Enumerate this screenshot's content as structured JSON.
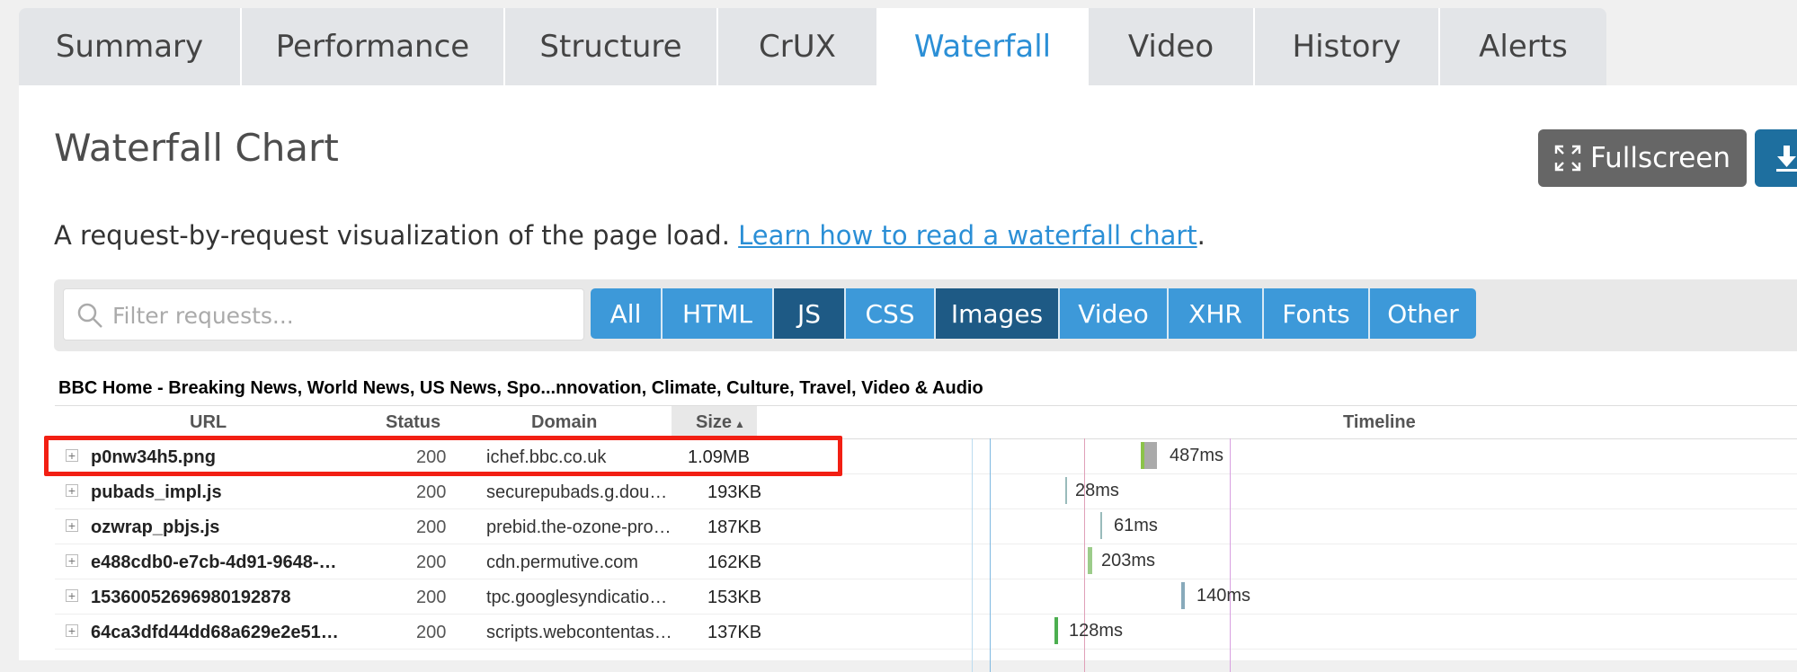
{
  "tabs": [
    {
      "label": "Summary",
      "active": false
    },
    {
      "label": "Performance",
      "active": false
    },
    {
      "label": "Structure",
      "active": false
    },
    {
      "label": "CrUX",
      "active": false
    },
    {
      "label": "Waterfall",
      "active": true
    },
    {
      "label": "Video",
      "active": false
    },
    {
      "label": "History",
      "active": false
    },
    {
      "label": "Alerts",
      "active": false
    }
  ],
  "header": {
    "title": "Waterfall Chart",
    "fullscreen_label": "Fullscreen"
  },
  "description": {
    "text": "A request-by-request visualization of the page load. ",
    "link": "Learn how to read a waterfall chart",
    "suffix": "."
  },
  "filter": {
    "placeholder": "Filter requests...",
    "buttons": [
      {
        "label": "All",
        "active": false
      },
      {
        "label": "HTML",
        "active": false
      },
      {
        "label": "JS",
        "active": true
      },
      {
        "label": "CSS",
        "active": false
      },
      {
        "label": "Images",
        "active": true
      },
      {
        "label": "Video",
        "active": false
      },
      {
        "label": "XHR",
        "active": false
      },
      {
        "label": "Fonts",
        "active": false
      },
      {
        "label": "Other",
        "active": false
      }
    ]
  },
  "page_name": "BBC Home - Breaking News, World News, US News, Spo...nnovation, Climate, Culture, Travel, Video & Audio",
  "table": {
    "headers": {
      "url": "URL",
      "status": "Status",
      "domain": "Domain",
      "size": "Size",
      "timeline": "Timeline"
    },
    "sort_indicator": "▲",
    "rows": [
      {
        "url": "p0nw34h5.png",
        "status": "200",
        "domain": "ichef.bbc.co.uk",
        "size": "1.09MB",
        "duration": "487ms"
      },
      {
        "url": "pubads_impl.js",
        "status": "200",
        "domain": "securepubads.g.dou…",
        "size": "193KB",
        "duration": "28ms"
      },
      {
        "url": "ozwrap_pbjs.js",
        "status": "200",
        "domain": "prebid.the-ozone-pro…",
        "size": "187KB",
        "duration": "61ms"
      },
      {
        "url": "e488cdb0-e7cb-4d91-9648-…",
        "status": "200",
        "domain": "cdn.permutive.com",
        "size": "162KB",
        "duration": "203ms"
      },
      {
        "url": "15360052696980192878",
        "status": "200",
        "domain": "tpc.googlesyndicatio…",
        "size": "153KB",
        "duration": "140ms"
      },
      {
        "url": "64ca3dfd44dd68a629e2e51…",
        "status": "200",
        "domain": "scripts.webcontentas…",
        "size": "137KB",
        "duration": "128ms"
      }
    ]
  },
  "colors": {
    "accent": "#2b8fd6",
    "filter_active": "#1e5a85",
    "highlight": "#f21f13"
  }
}
